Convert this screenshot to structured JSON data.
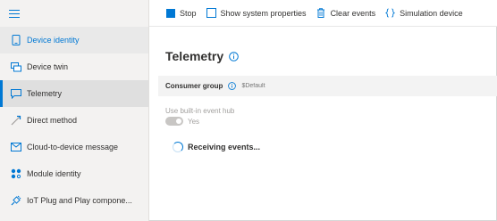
{
  "sidebar": {
    "items": [
      {
        "label": "Device identity",
        "icon": "device-icon"
      },
      {
        "label": "Device twin",
        "icon": "twin-icon"
      },
      {
        "label": "Telemetry",
        "icon": "telemetry-icon"
      },
      {
        "label": "Direct method",
        "icon": "method-icon"
      },
      {
        "label": "Cloud-to-device message",
        "icon": "message-icon"
      },
      {
        "label": "Module identity",
        "icon": "module-icon"
      },
      {
        "label": "IoT Plug and Play compone...",
        "icon": "plug-icon"
      }
    ],
    "active_index": 2
  },
  "toolbar": {
    "stop_label": "Stop",
    "show_props_label": "Show system properties",
    "clear_label": "Clear events",
    "simulation_label": "Simulation device"
  },
  "main": {
    "title": "Telemetry",
    "consumer_group_label": "Consumer group",
    "consumer_group_placeholder": "$Default",
    "builtin_hub_label": "Use built-in event hub",
    "toggle_label": "Yes",
    "status": "Receiving events..."
  },
  "colors": {
    "accent": "#0078d4",
    "sidebar_bg": "#f3f2f1",
    "active_bg": "#dfdfdf"
  }
}
